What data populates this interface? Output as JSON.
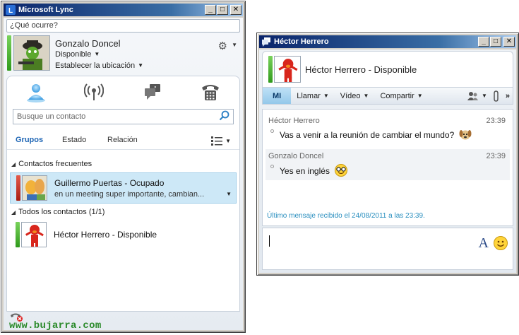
{
  "main_window": {
    "title": "Microsoft Lync",
    "status_placeholder": "¿Qué ocurre?",
    "me": {
      "name": "Gonzalo Doncel",
      "status": "Disponible",
      "location": "Establecer la ubicación"
    },
    "search_placeholder": "Busque un contacto",
    "filter_tabs": [
      "Grupos",
      "Estado",
      "Relación"
    ],
    "groups": [
      {
        "label": "Contactos frecuentes",
        "contacts": [
          {
            "name": "Guillermo Puertas - Ocupado",
            "note": "en un meeting super importante, cambian..."
          }
        ]
      },
      {
        "label": "Todos los contactos (1/1)",
        "contacts": [
          {
            "name": "Héctor Herrero - Disponible"
          }
        ]
      }
    ],
    "watermark": "www.bujarra.com"
  },
  "conversation": {
    "title": "Héctor Herrero",
    "header_title": "Héctor Herrero - Disponible",
    "toolbar": {
      "mi": "MI",
      "llamar": "Llamar",
      "video": "Vídeo",
      "compartir": "Compartir"
    },
    "messages": [
      {
        "sender": "Héctor Herrero",
        "time": "23:39",
        "text": "Vas a venir a la reunión de cambiar el mundo?"
      },
      {
        "sender": "Gonzalo Doncel",
        "time": "23:39",
        "text": "Yes en inglés"
      }
    ],
    "last_message": "Último mensaje recibido el 24/08/2011 a las 23:39."
  },
  "colors": {
    "titlebar": "#0a246a",
    "available": "#3aa424",
    "busy": "#c0392b",
    "accent": "#1f66b5"
  }
}
